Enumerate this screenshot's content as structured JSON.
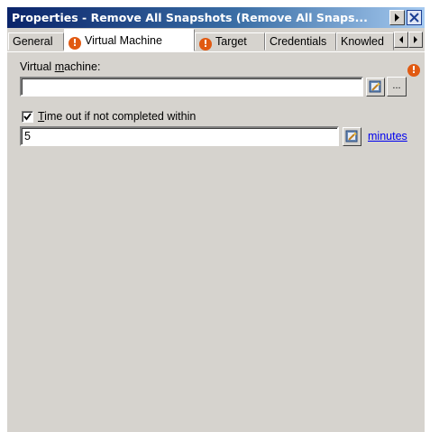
{
  "window": {
    "title": "Properties - Remove All Snapshots (Remove All Snaps..."
  },
  "tabs": [
    {
      "label": "General",
      "warning": false,
      "active": false
    },
    {
      "label": "Virtual Machine",
      "warning": true,
      "active": true
    },
    {
      "label": "Target",
      "warning": true,
      "active": false
    },
    {
      "label": "Credentials",
      "warning": false,
      "active": false
    },
    {
      "label": "Knowled",
      "warning": false,
      "active": false
    }
  ],
  "form": {
    "vm_label_prefix": "Virtual ",
    "vm_label_mnemonic": "m",
    "vm_label_suffix": "achine:",
    "vm_value": "",
    "browse_label": "...",
    "timeout_checked": true,
    "timeout_label_mnemonic": "T",
    "timeout_label_rest": "ime out if not completed within",
    "timeout_value": "5",
    "units_link": "minutes"
  },
  "icons": {
    "warning": "!",
    "warning_color": "#e15a12",
    "titlebar_bg": "#0a246a"
  }
}
